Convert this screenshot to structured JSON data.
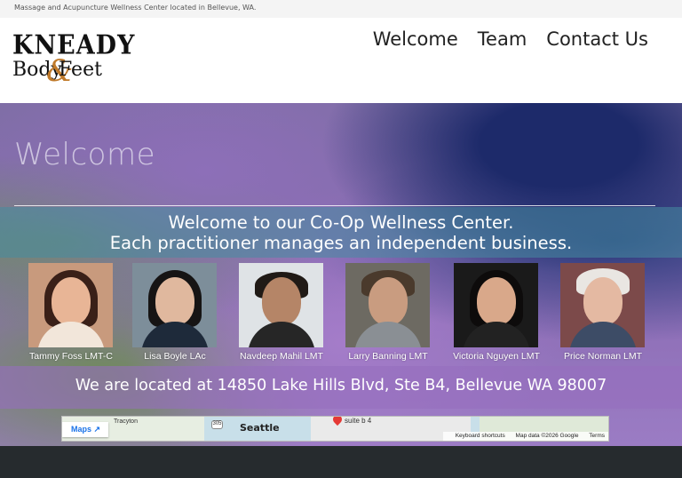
{
  "topbar": {
    "tagline": "Massage and Acupuncture Wellness Center located in Bellevue, WA."
  },
  "logo": {
    "line1": "KNEADY",
    "line2": "Body",
    "amp": "&",
    "line3": "Feet"
  },
  "nav": [
    {
      "label": "Welcome"
    },
    {
      "label": "Team"
    },
    {
      "label": "Contact Us"
    }
  ],
  "hero": {
    "title": "Welcome",
    "band1_line1": "Welcome to our Co-Op Wellness Center.",
    "band1_line2": "Each practitioner manages an independent business.",
    "practitioners": [
      {
        "name": "Tammy Foss LMT-C"
      },
      {
        "name": "Lisa Boyle LAc"
      },
      {
        "name": "Navdeep Mahil LMT"
      },
      {
        "name": "Larry Banning LMT"
      },
      {
        "name": "Victoria Nguyen LMT"
      },
      {
        "name": "Price Norman LMT"
      }
    ],
    "address": "We are located at 14850 Lake Hills Blvd, Ste B4, Bellevue WA 98007"
  },
  "map": {
    "maps_button": "Maps",
    "city": "Seattle",
    "town": "Tracyton",
    "suite": "suite b 4",
    "road": "305",
    "footer_shortcuts": "Keyboard shortcuts",
    "footer_data": "Map data ©2026 Google",
    "footer_terms": "Terms"
  },
  "colors": {
    "accent_band_teal": "#468ca0",
    "accent_band_purple": "#966ebe",
    "footer_dark": "#262b2e"
  }
}
